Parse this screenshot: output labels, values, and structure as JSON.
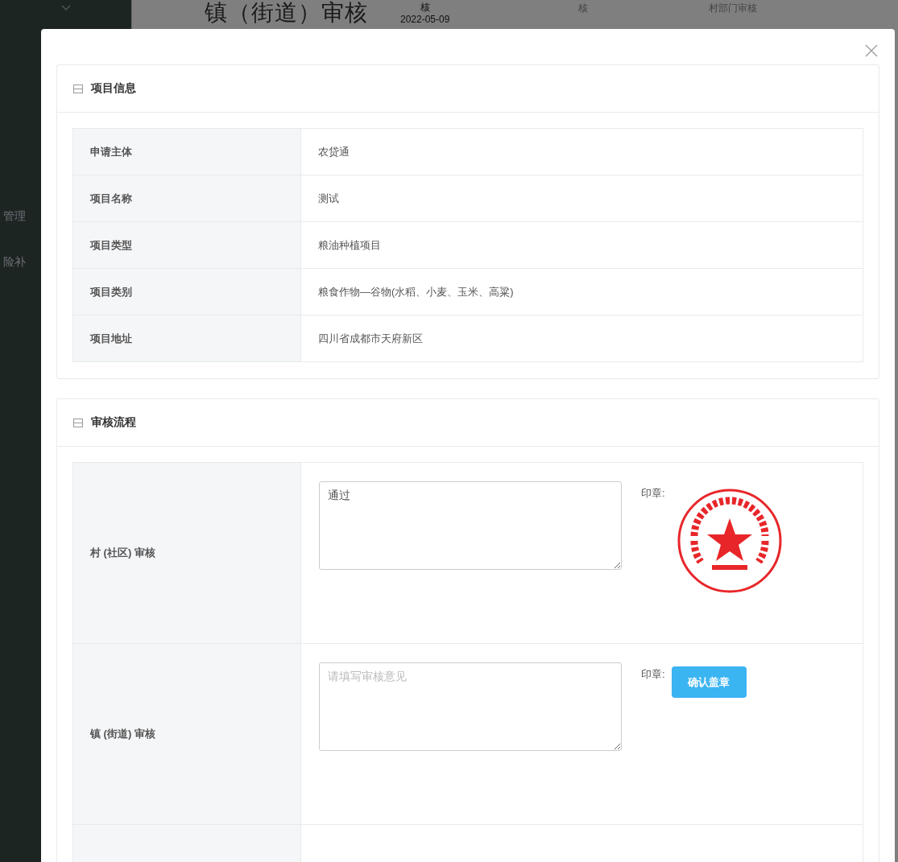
{
  "background": {
    "sidebar_items": [
      "管理",
      "险补"
    ],
    "heading": "镇（街道）审核",
    "column_2_top": "核",
    "column_2_date": "2022-05-09",
    "column_3": "核",
    "column_4": "村部门审核"
  },
  "modal": {
    "sections": [
      {
        "kind": "info",
        "title": "项目信息",
        "rows": [
          {
            "label": "申请主体",
            "value": "农贷通"
          },
          {
            "label": "项目名称",
            "value": "测试"
          },
          {
            "label": "项目类型",
            "value": "粮油种植项目"
          },
          {
            "label": "项目类别",
            "value": "粮食作物—谷物(水稻、小麦、玉米、高粱)"
          },
          {
            "label": "项目地址",
            "value": "四川省成都市天府新区"
          }
        ]
      },
      {
        "kind": "review",
        "title": "审核流程",
        "rows": [
          {
            "kind": "stamped",
            "label": "村 (社区) 审核",
            "opinion": {
              "value": "通过"
            },
            "seal_label": "印章:"
          },
          {
            "kind": "pending",
            "label": "镇 (街道) 审核",
            "opinion": {
              "placeholder": "请填写审核意见"
            },
            "seal_label": "印章:",
            "button": "确认盖章"
          },
          {
            "kind": "empty"
          }
        ]
      }
    ]
  }
}
